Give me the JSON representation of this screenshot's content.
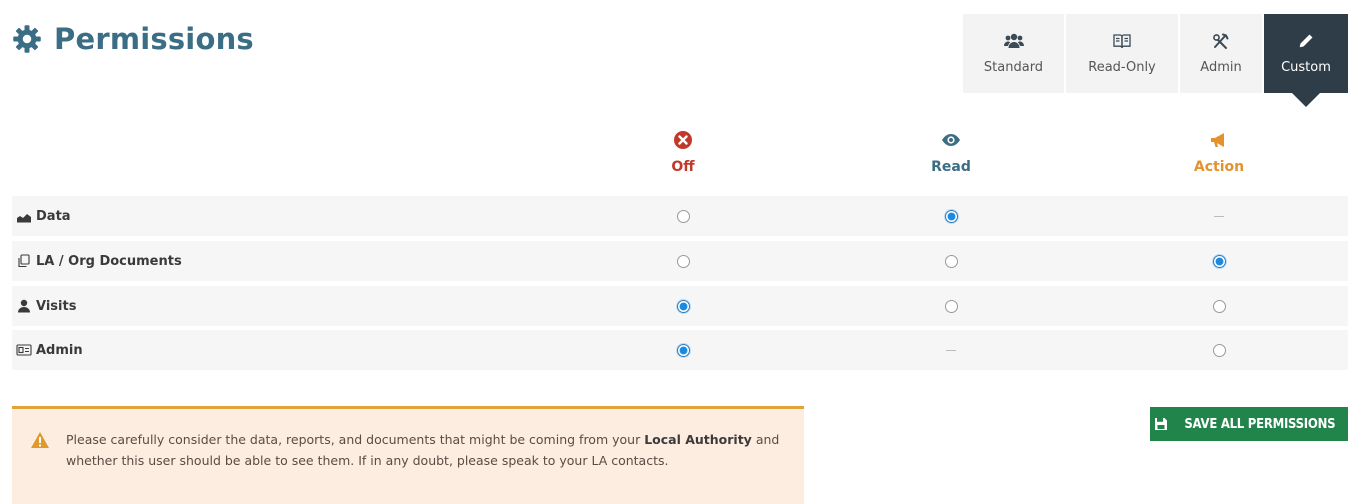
{
  "page": {
    "title": "Permissions"
  },
  "presets": [
    {
      "label": "Standard",
      "icon": "users-icon",
      "active": false
    },
    {
      "label": "Read-Only",
      "icon": "book-icon",
      "active": false
    },
    {
      "label": "Admin",
      "icon": "tools-icon",
      "active": false
    },
    {
      "label": "Custom",
      "icon": "pencil-icon",
      "active": true
    }
  ],
  "columns": [
    {
      "key": "off",
      "label": "Off",
      "icon": "circle-x-icon",
      "color": "#c0392b"
    },
    {
      "key": "read",
      "label": "Read",
      "icon": "eye-icon",
      "color": "#3b6e85"
    },
    {
      "key": "action",
      "label": "Action",
      "icon": "megaphone-icon",
      "color": "#e5922c"
    }
  ],
  "rows": [
    {
      "label": "Data",
      "icon": "area-chart-icon",
      "cells": [
        "off",
        "on",
        "na"
      ]
    },
    {
      "label": "LA / Org Documents",
      "icon": "copy-icon",
      "cells": [
        "off",
        "off",
        "on"
      ]
    },
    {
      "label": "Visits",
      "icon": "user-icon",
      "cells": [
        "on",
        "off",
        "off"
      ]
    },
    {
      "label": "Admin",
      "icon": "id-card-icon",
      "cells": [
        "on",
        "na",
        "off"
      ]
    }
  ],
  "warning": {
    "text_1": "Please carefully consider the data, reports, and documents that might be coming from your ",
    "bold": "Local Authority",
    "text_2": " and whether this user should be able to see them. If in any doubt, please speak to your LA contacts."
  },
  "save_button": {
    "label": "SAVE ALL PERMISSIONS",
    "color": "#21844a"
  }
}
